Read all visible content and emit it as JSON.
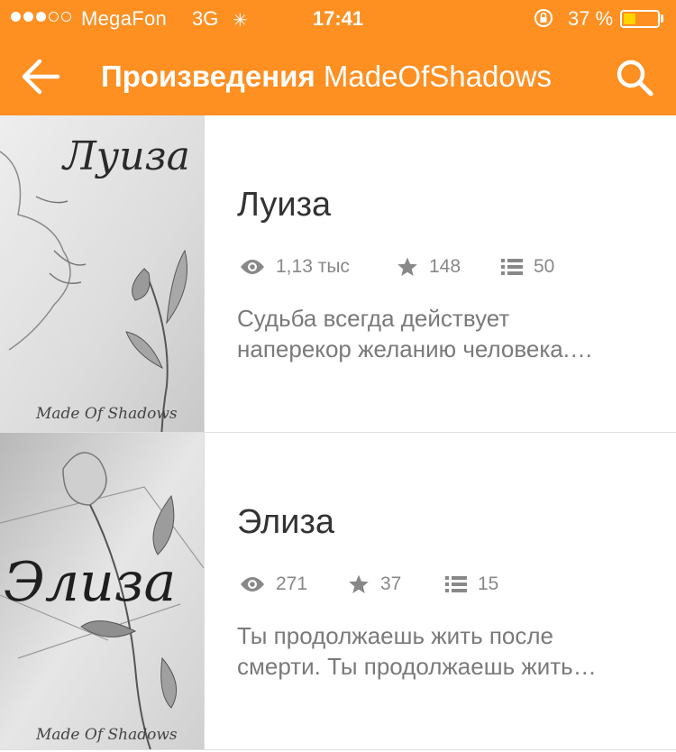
{
  "status_bar": {
    "carrier": "MegaFon",
    "network": "3G",
    "time": "17:41",
    "battery_percent": "37 %",
    "battery_level": 0.37,
    "signal_bars_filled": 3,
    "signal_bars_total": 5
  },
  "header": {
    "title_bold": "Произведения",
    "title_name": "MadeOfShadows",
    "background_color": "#fe8f21",
    "back_icon": "arrow-left-icon",
    "search_icon": "search-icon"
  },
  "stories": [
    {
      "title": "Луиза",
      "reads": "1,13 тыс",
      "votes": "148",
      "parts": "50",
      "description_line1": "Судьба всегда действует",
      "description_line2": "наперекор желанию человека.…",
      "cover_title": "Луиза",
      "cover_author": "Made Of Shadows"
    },
    {
      "title": "Элиза",
      "reads": "271",
      "votes": "37",
      "parts": "15",
      "description_line1": "Ты продолжаешь жить после",
      "description_line2": "смерти. Ты продолжаешь жить…",
      "cover_title": "Элиза",
      "cover_author": "Made Of Shadows"
    }
  ]
}
